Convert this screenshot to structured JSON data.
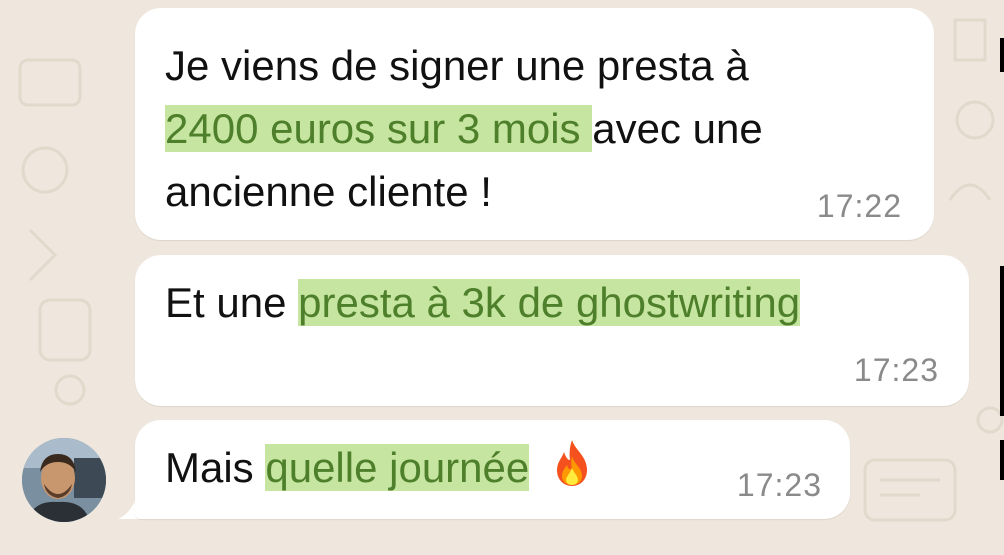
{
  "messages": [
    {
      "line1": "Je viens de signer une presta à",
      "line2_highlight": "2400 euros sur 3 mois ",
      "line2_rest": "avec une",
      "line3": "ancienne cliente !",
      "time": "17:22"
    },
    {
      "prefix": "Et une ",
      "highlight": "presta à 3k de ghostwriting",
      "time": "17:23"
    },
    {
      "prefix": "Mais ",
      "highlight": "quelle journée",
      "emoji": "fire-emoji",
      "time": "17:23"
    }
  ],
  "sender": {
    "avatar": "avatar-photo"
  },
  "colors": {
    "background": "#efe7dd",
    "bubble": "#ffffff",
    "highlight_bg": "#c5e5a0",
    "highlight_text": "#4e7f2b",
    "timestamp": "#8a8a8a"
  }
}
